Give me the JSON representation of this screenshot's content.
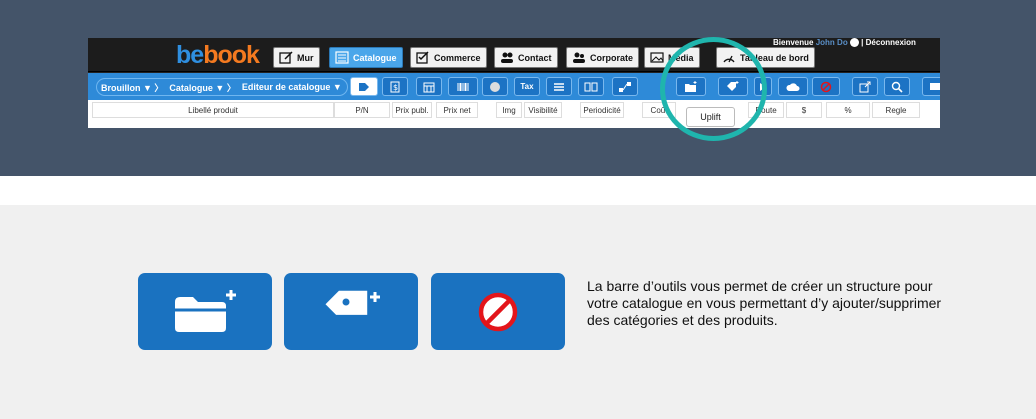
{
  "logo": {
    "part1": "be",
    "part2": "book"
  },
  "nav": {
    "mur": "Mur",
    "catalogue": "Catalogue",
    "commerce": "Commerce",
    "contact": "Contact",
    "corporate": "Corporate",
    "media": "Media",
    "tableau": "Tableau de bord"
  },
  "header": {
    "welcome": "Bienvenue",
    "user": "John Do",
    "separator": "|",
    "logout": "Déconnexion"
  },
  "breadcrumb": {
    "item1": "Brouillon ▼ 〉",
    "item2": "Catalogue ▼ 〉",
    "item3": "Editeur de catalogue ▼"
  },
  "toolbar": {
    "tax_label": "Tax",
    "tooltip": "Uplift"
  },
  "columns": {
    "libelle": "Libellé produit",
    "pn": "P/N",
    "prix_publ": "Prix publ.",
    "prix_net": "Prix net",
    "img": "Img",
    "visibilite": "Visibilité",
    "periodicite": "Periodicité",
    "cout": "Coût",
    "route": "Route",
    "dollar": "$",
    "percent": "%",
    "regle": "Regle"
  },
  "description": "La barre d’outils vous permet de créer un structure pour votre catalogue en vous permettant d’y ajouter/supprimer des catégories et des produits.",
  "colors": {
    "band": "#445469",
    "toolbar": "#2e8ad8",
    "button": "#1a72c0",
    "highlight": "#1fb5ad",
    "forbidden": "#e3151b"
  },
  "icons": [
    "folder-add-icon",
    "tag-add-icon",
    "forbidden-icon"
  ]
}
